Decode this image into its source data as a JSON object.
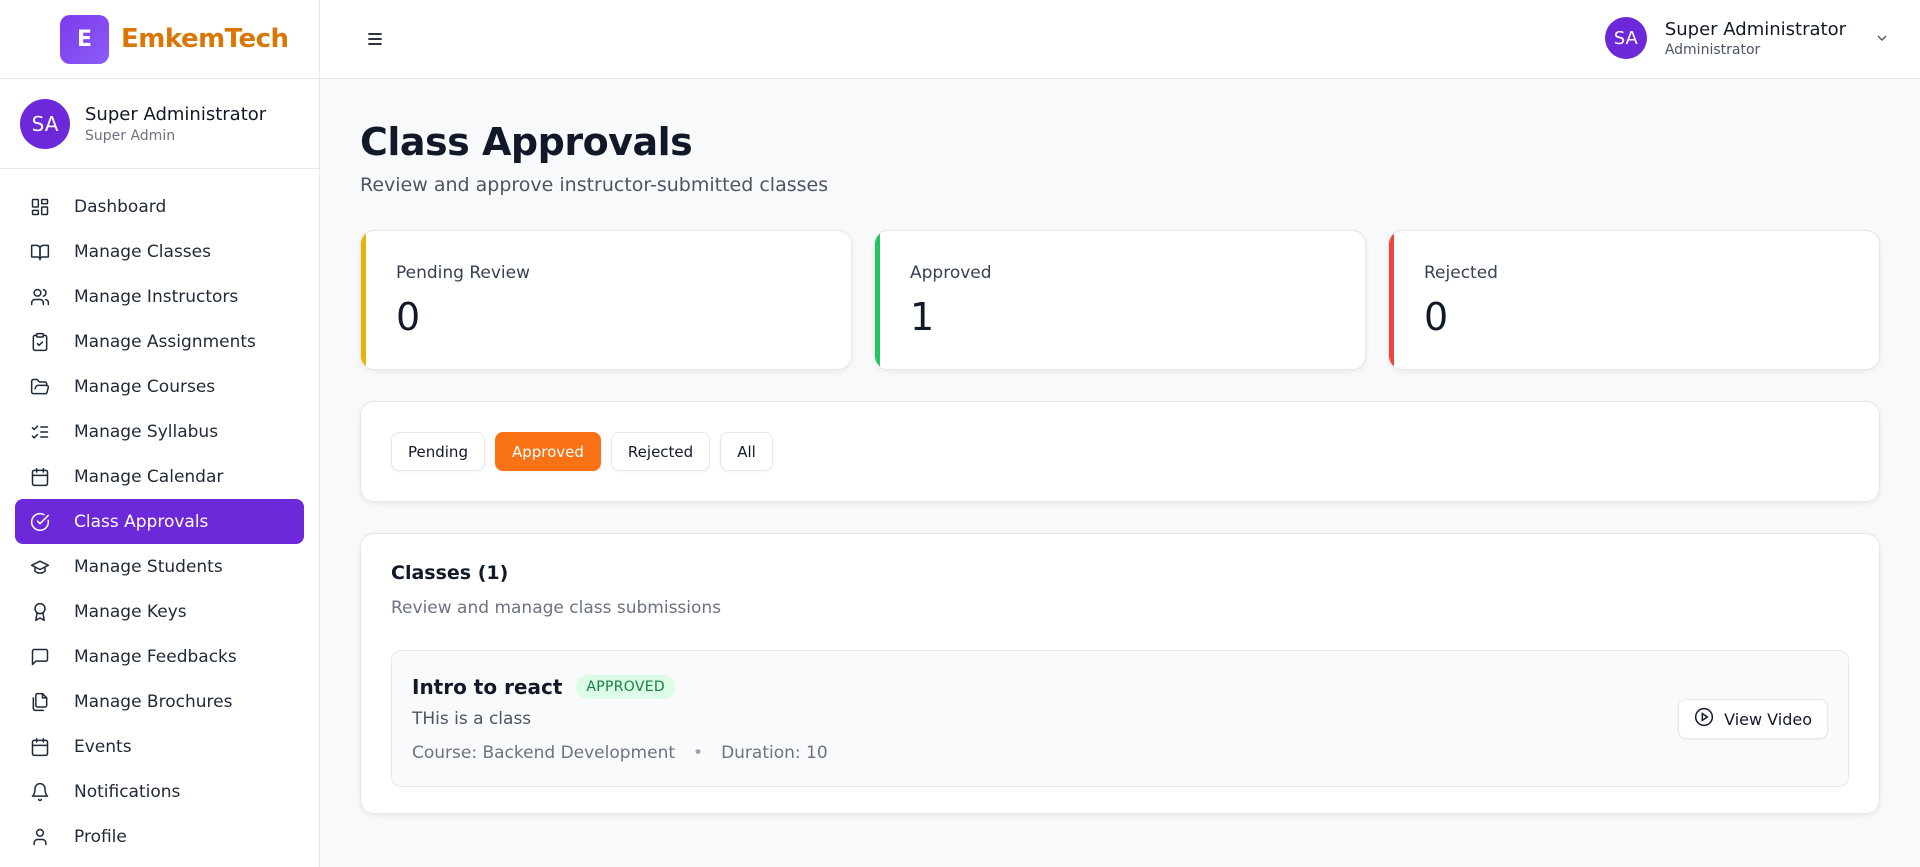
{
  "brand": {
    "logo_letter": "E",
    "name": "EmkemTech",
    "accent": "#d97706"
  },
  "sidebar_user": {
    "initials": "SA",
    "name": "Super Administrator",
    "role": "Super Admin"
  },
  "nav": {
    "items": [
      {
        "label": "Dashboard",
        "icon": "grid-icon"
      },
      {
        "label": "Manage Classes",
        "icon": "book-open-icon"
      },
      {
        "label": "Manage Instructors",
        "icon": "users-icon"
      },
      {
        "label": "Manage Assignments",
        "icon": "clipboard-check-icon"
      },
      {
        "label": "Manage Courses",
        "icon": "folder-open-icon"
      },
      {
        "label": "Manage Syllabus",
        "icon": "list-checks-icon"
      },
      {
        "label": "Manage Calendar",
        "icon": "calendar-icon"
      },
      {
        "label": "Class Approvals",
        "icon": "check-circle-icon",
        "active": true
      },
      {
        "label": "Manage Students",
        "icon": "graduation-cap-icon"
      },
      {
        "label": "Manage Keys",
        "icon": "award-icon"
      },
      {
        "label": "Manage Feedbacks",
        "icon": "message-square-icon"
      },
      {
        "label": "Manage Brochures",
        "icon": "files-icon"
      },
      {
        "label": "Events",
        "icon": "calendar-icon"
      },
      {
        "label": "Notifications",
        "icon": "bell-icon"
      },
      {
        "label": "Profile",
        "icon": "user-icon"
      }
    ],
    "active_color": "#6d28d9"
  },
  "header": {
    "menu_icon": "hamburger-icon",
    "user": {
      "initials": "SA",
      "name": "Super Administrator",
      "role": "Administrator"
    }
  },
  "page": {
    "title": "Class Approvals",
    "subtitle": "Review and approve instructor-submitted classes"
  },
  "stats": {
    "pending": {
      "label": "Pending Review",
      "value": "0",
      "color": "#eab308"
    },
    "approved": {
      "label": "Approved",
      "value": "1",
      "color": "#22c55e"
    },
    "rejected": {
      "label": "Rejected",
      "value": "0",
      "color": "#ef4444"
    }
  },
  "filters": {
    "pending": "Pending",
    "approved": "Approved",
    "rejected": "Rejected",
    "all": "All",
    "selected": "Approved",
    "selected_color": "#f97316"
  },
  "classes": {
    "title": "Classes (1)",
    "subtitle": "Review and manage class submissions",
    "items": [
      {
        "title": "Intro to react",
        "status": "APPROVED",
        "description": "THis is a class",
        "course": "Course: Backend Development",
        "duration": "Duration: 10",
        "separator": "•",
        "action_label": "View Video"
      }
    ]
  }
}
